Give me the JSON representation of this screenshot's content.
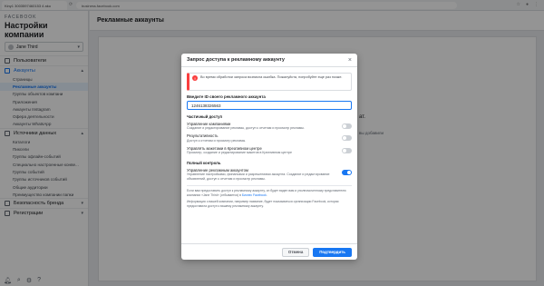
{
  "browser": {
    "tab_title": "Kiny1 3003597460153 4 ako",
    "url": "business.facebook.com"
  },
  "sidebar": {
    "brand": "FACEBOOK",
    "title": "Настройки компании",
    "user": "Jane Third",
    "sections": [
      {
        "label": "Пользователи",
        "icon": "people-icon"
      },
      {
        "label": "Аккаунты",
        "icon": "briefcase-icon",
        "active": true,
        "items": [
          "Страницы",
          "Рекламные аккаунты",
          "Группы объектов компани",
          "Приложения",
          "Аккаунты Instagram",
          "Офера деятельности",
          "Аккаунты WhatsApp"
        ]
      },
      {
        "label": "Источники данных",
        "icon": "database-icon",
        "items": [
          "Каталоги",
          "Пиксели",
          "Группы офлайн-событий",
          "Специально настроенные конве...",
          "Группы событий",
          "Группы источников событий",
          "Общие аудитории",
          "Преимущество компании папки"
        ]
      },
      {
        "label": "Безопасность бренда",
        "icon": "shield-icon"
      },
      {
        "label": "Регистрации",
        "icon": "document-icon"
      }
    ],
    "selected_item": "Рекламные аккаунты"
  },
  "main": {
    "title": "Рекламные аккаунты",
    "bg_fragment_1": "ат.",
    "bg_fragment_2": "вы добавили"
  },
  "modal": {
    "title": "Запрос доступа к рекламному аккаунту",
    "error": "Во время обработки запроса возникла ошибка. Пожалуйста, попробуйте еще раз позже.",
    "input_label": "Введите ID своего рекламного аккаунта",
    "input_value": "1246138326563",
    "group_partial": "Частичный доступ",
    "permissions_partial": [
      {
        "title": "Управление кампаниями",
        "desc": "Создание и редактирование рекламы, доступ к отчетам и просмотр рекламы.",
        "on": false
      },
      {
        "title": "Результативность",
        "desc": "Доступ к отчетам и просмотр рекламы.",
        "on": false
      },
      {
        "title": "Управлять макетами в Креативном центре",
        "desc": "Просмотр, создание и редактирование макетов в Креативном центре",
        "on": false
      }
    ],
    "group_full": "Полный контроль",
    "permissions_full": [
      {
        "title": "Управление рекламным аккаунтом",
        "desc": "Управление настройками, финансами и разрешениями аккаунта. Создание и редактирование объявлений, доступ к отчетам и просмотр рекламы.",
        "on": true
      }
    ],
    "note_1a": "Если вам предоставить доступ к рекламному аккаунту, он будет виден вам и уполномоченному представителю компании «Jane Third» (отбывается) в",
    "note_1_link": "Бизнес Facebook",
    "note_2": "Информация о вашей компании, например название, будет показываться организации Facebook, которая предоставила доступ к вашему рекламному аккаунту.",
    "cancel_label": "Отмена",
    "confirm_label": "Подтвердить"
  },
  "colors": {
    "accent": "#1877f2",
    "error": "#fa3e3e"
  }
}
